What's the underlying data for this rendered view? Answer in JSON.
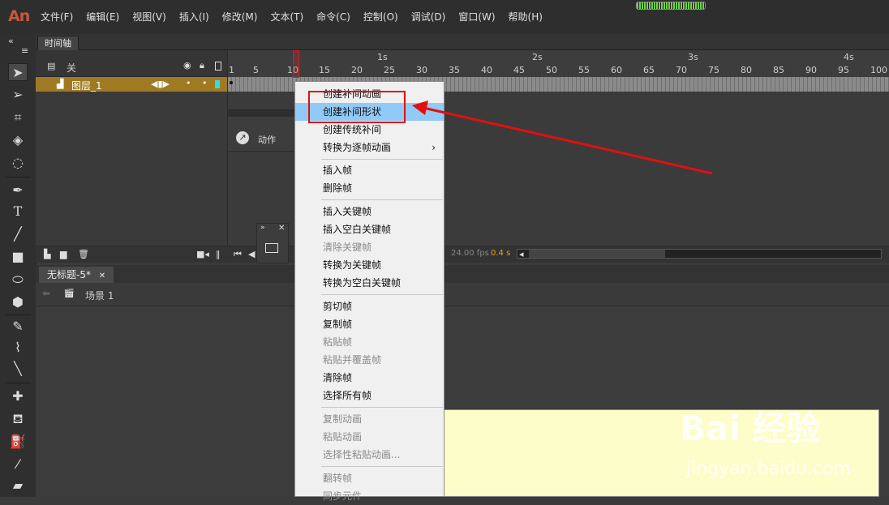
{
  "app": {
    "logo": "An",
    "menus": [
      "文件(F)",
      "编辑(E)",
      "视图(V)",
      "插入(I)",
      "修改(M)",
      "文本(T)",
      "命令(C)",
      "控制(O)",
      "调试(D)",
      "窗口(W)",
      "帮助(H)"
    ]
  },
  "timeline": {
    "tab_label": "时间轴",
    "header_label": "关",
    "layer_name": "图层_1",
    "seconds": [
      "1s",
      "2s",
      "3s",
      "4s"
    ],
    "frame_numbers": [
      "1",
      "5",
      "10",
      "15",
      "20",
      "25",
      "30",
      "35",
      "40",
      "45",
      "50",
      "55",
      "60",
      "65",
      "70",
      "75",
      "80",
      "85",
      "90",
      "95",
      "100"
    ],
    "fps": "24.00 fps",
    "time": "0.4 s"
  },
  "action_panel": {
    "label": "动作"
  },
  "document": {
    "tab_label": "无标题-5*",
    "scene_label": "场景 1"
  },
  "context_menu": {
    "items": [
      {
        "label": "创建补间动画",
        "disabled": false
      },
      {
        "label": "创建补间形状",
        "disabled": false,
        "highlighted": true
      },
      {
        "label": "创建传统补间",
        "disabled": false
      },
      {
        "label": "转换为逐帧动画",
        "disabled": false,
        "submenu": true
      },
      {
        "label": "插入帧",
        "disabled": false
      },
      {
        "label": "删除帧",
        "disabled": false
      },
      {
        "label": "插入关键帧",
        "disabled": false
      },
      {
        "label": "插入空白关键帧",
        "disabled": false
      },
      {
        "label": "清除关键帧",
        "disabled": true
      },
      {
        "label": "转换为关键帧",
        "disabled": false
      },
      {
        "label": "转换为空白关键帧",
        "disabled": false
      },
      {
        "label": "剪切帧",
        "disabled": false
      },
      {
        "label": "复制帧",
        "disabled": false
      },
      {
        "label": "粘贴帧",
        "disabled": true
      },
      {
        "label": "粘贴并覆盖帧",
        "disabled": true
      },
      {
        "label": "清除帧",
        "disabled": false
      },
      {
        "label": "选择所有帧",
        "disabled": false
      },
      {
        "label": "复制动画",
        "disabled": true
      },
      {
        "label": "粘贴动画",
        "disabled": true
      },
      {
        "label": "选择性粘贴动画...",
        "disabled": true
      },
      {
        "label": "翻转帧",
        "disabled": true
      },
      {
        "label": "同步元件",
        "disabled": true
      }
    ]
  },
  "watermark": {
    "main": "Bai 经验",
    "sub": "jingyan.baidu.com"
  },
  "colors": {
    "annotation": "#e01010",
    "highlight": "#91c9f7",
    "layer": "#a07a22",
    "logo": "#c9583a"
  }
}
